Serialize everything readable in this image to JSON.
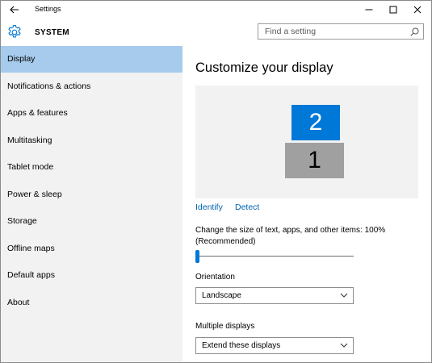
{
  "window": {
    "title": "Settings",
    "controls": [
      "minimize",
      "maximize",
      "close"
    ]
  },
  "header": {
    "section_title": "SYSTEM",
    "search_placeholder": "Find a setting"
  },
  "sidebar": {
    "items": [
      {
        "label": "Display",
        "selected": true
      },
      {
        "label": "Notifications & actions",
        "selected": false
      },
      {
        "label": "Apps & features",
        "selected": false
      },
      {
        "label": "Multitasking",
        "selected": false
      },
      {
        "label": "Tablet mode",
        "selected": false
      },
      {
        "label": "Power & sleep",
        "selected": false
      },
      {
        "label": "Storage",
        "selected": false
      },
      {
        "label": "Offline maps",
        "selected": false
      },
      {
        "label": "Default apps",
        "selected": false
      },
      {
        "label": "About",
        "selected": false
      }
    ]
  },
  "main": {
    "title": "Customize your display",
    "monitors": {
      "secondary": "2",
      "primary": "1"
    },
    "links": {
      "identify": "Identify",
      "detect": "Detect"
    },
    "scale_label": "Change the size of text, apps, and other items: 100% (Recommended)",
    "scale_slider_value": 0,
    "orientation_label": "Orientation",
    "orientation_value": "Landscape",
    "multiple_displays_label": "Multiple displays",
    "multiple_displays_value": "Extend these displays"
  },
  "colors": {
    "accent": "#0078d7",
    "sidebar_bg": "#f2f2f2",
    "selected_bg": "#a6cbec",
    "link": "#0063b1",
    "primary_monitor": "#a0a0a0"
  },
  "icons": [
    "back-arrow-icon",
    "gear-icon",
    "search-icon",
    "minimize-icon",
    "maximize-icon",
    "close-icon",
    "chevron-down-icon"
  ]
}
